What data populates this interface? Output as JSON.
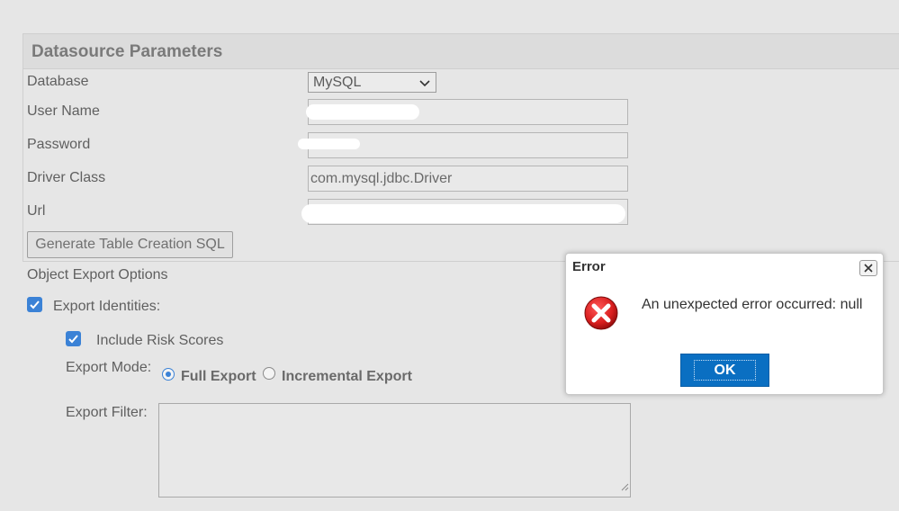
{
  "panel": {
    "title": "Datasource Parameters"
  },
  "form": {
    "database_label": "Database",
    "database_value": "MySQL",
    "username_label": "User Name",
    "password_label": "Password",
    "driver_label": "Driver Class",
    "driver_value": "com.mysql.jdbc.Driver",
    "url_label": "Url",
    "generate_button": "Generate Table Creation SQL"
  },
  "export_options": {
    "section_label": "Object Export Options",
    "export_identities_label": "Export Identities:",
    "export_identities_checked": true,
    "include_risk_label": "Include Risk Scores",
    "include_risk_checked": true,
    "export_mode_label": "Export Mode:",
    "mode_options": [
      "Full Export",
      "Incremental Export"
    ],
    "mode_selected": "Full Export",
    "export_filter_label": "Export Filter:"
  },
  "dialog": {
    "title": "Error",
    "message": "An unexpected error occurred: null",
    "ok_label": "OK"
  },
  "colors": {
    "accent": "#3b82d6",
    "ok_button": "#0a6fc2",
    "error_red": "#d81e1e"
  },
  "icons": [
    "chevron-down-icon",
    "checkbox-check-icon",
    "close-icon",
    "error-icon",
    "resize-grip-icon"
  ]
}
